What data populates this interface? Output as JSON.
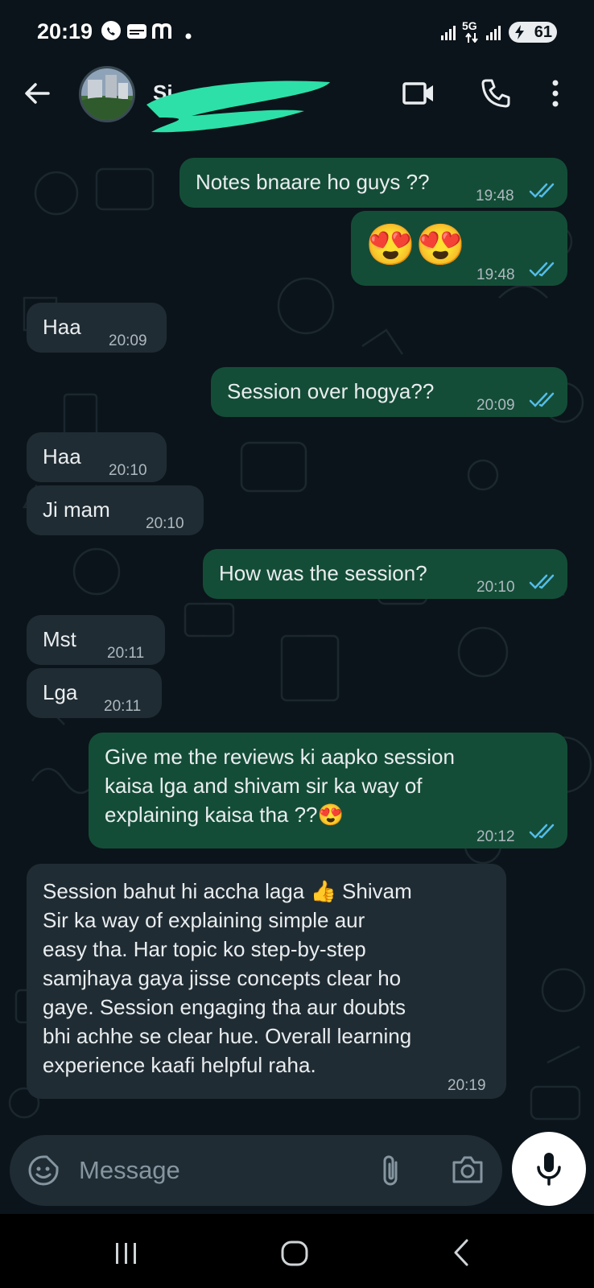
{
  "status_bar": {
    "time": "20:19",
    "app_icons": [
      "whatsapp-icon",
      "tring-icon",
      "m-app-icon",
      "dot-icon"
    ],
    "network": "5G",
    "battery": "61"
  },
  "header": {
    "contact_name": "Si",
    "icons": {
      "back": "arrow-left-icon",
      "video": "video-camera-icon",
      "call": "phone-icon",
      "menu": "more-vertical-icon"
    }
  },
  "messages": [
    {
      "direction": "out",
      "text": "Notes bnaare ho guys ??",
      "time": "19:48",
      "status": "read"
    },
    {
      "direction": "out",
      "text": "😍😍",
      "time": "19:48",
      "status": "read"
    },
    {
      "direction": "in",
      "text": "Haa",
      "time": "20:09"
    },
    {
      "direction": "out",
      "text": "Session over hogya??",
      "time": "20:09",
      "status": "read"
    },
    {
      "direction": "in",
      "text": "Haa",
      "time": "20:10"
    },
    {
      "direction": "in",
      "text": "Ji mam",
      "time": "20:10"
    },
    {
      "direction": "out",
      "text": "How was the session?",
      "time": "20:10",
      "status": "read"
    },
    {
      "direction": "in",
      "text": "Mst",
      "time": "20:11"
    },
    {
      "direction": "in",
      "text": "Lga",
      "time": "20:11"
    },
    {
      "direction": "out",
      "text": "Give me the reviews ki aapko session\nkaisa lga and shivam sir ka way of\nexplaining kaisa tha ??😍",
      "time": "20:12",
      "status": "read"
    },
    {
      "direction": "in",
      "text": "Session bahut hi accha laga 👍 Shivam\nSir ka way of explaining simple aur\neasy tha. Har topic ko step-by-step\nsamjhaya gaya jisse concepts clear ho\ngaye. Session engaging tha aur doubts\nbhi achhe se clear hue. Overall learning\nexperience kaafi helpful raha.",
      "time": "20:19"
    }
  ],
  "input": {
    "placeholder": "Message"
  },
  "colors": {
    "background": "#0b141a",
    "outgoing_bubble": "#144d37",
    "incoming_bubble": "#202c33",
    "read_ticks": "#53bdeb",
    "input_bar": "#1f2c34"
  }
}
